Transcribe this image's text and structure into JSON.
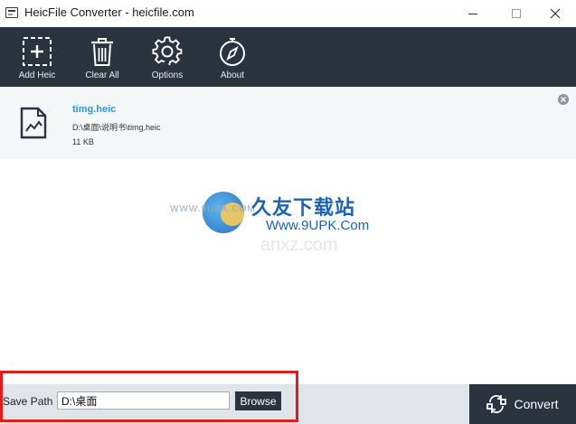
{
  "window": {
    "title": "HeicFile Converter - heicfile.com"
  },
  "toolbar": {
    "items": [
      {
        "label": "Add Heic",
        "icon": "add-file-icon"
      },
      {
        "label": "Clear All",
        "icon": "trash-icon"
      },
      {
        "label": "Options",
        "icon": "gear-icon"
      },
      {
        "label": "About",
        "icon": "compass-icon"
      }
    ]
  },
  "files": [
    {
      "name": "timg.heic",
      "path": "D:\\桌面\\说明书\\timg.heic",
      "size": "11 KB"
    }
  ],
  "watermark": {
    "url": "WWW.9UPK.COM",
    "brand_cn": "久友下载站",
    "brand_site": "Www.9UPK.Com",
    "shadow_text": "anxz.com"
  },
  "bottom": {
    "save_label": "Save Path",
    "save_path": "D:\\桌面",
    "browse_label": "Browse",
    "convert_label": "Convert"
  },
  "colors": {
    "toolbar_bg": "#2b333e",
    "accent_blue": "#2f95d5",
    "highlight_red": "#e01d1d",
    "bottom_bg": "#e1e4e8"
  }
}
